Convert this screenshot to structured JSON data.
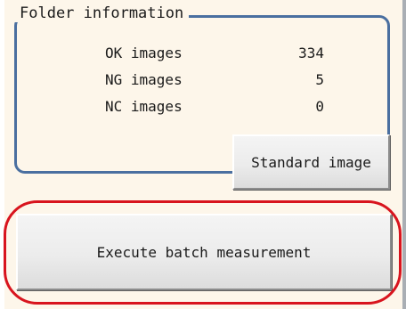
{
  "folder_info": {
    "title": "Folder information",
    "rows": [
      {
        "label": "OK images",
        "value": "334"
      },
      {
        "label": "NG images",
        "value": "5"
      },
      {
        "label": "NC images",
        "value": "0"
      }
    ]
  },
  "buttons": {
    "standard_image": "Standard image",
    "execute_batch": "Execute batch measurement"
  },
  "colors": {
    "group_border": "#4a6fa0",
    "highlight": "#d8141e",
    "panel_background": "#fdf6ea"
  }
}
